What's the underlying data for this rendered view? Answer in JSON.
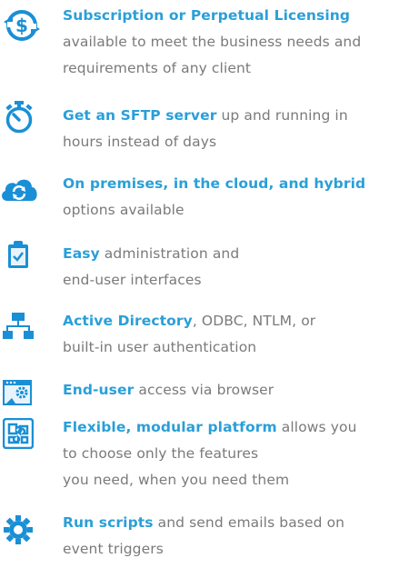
{
  "accent_color": "#2a9fd8",
  "icon_color": "#1a8fd6",
  "features": [
    {
      "icon": "dollar-cycle-icon",
      "highlight": "Subscription or Perpetual Licensing",
      "line1_rest": "",
      "line2": "available to meet the business needs and",
      "line3": "requirements of any client"
    },
    {
      "icon": "stopwatch-icon",
      "highlight": "Get an SFTP server",
      "line1_rest": " up and running in",
      "line2": "hours instead of days"
    },
    {
      "icon": "cloud-sync-icon",
      "highlight": "On premises, in the cloud, and hybrid",
      "line1_rest": "",
      "line2": "options available"
    },
    {
      "icon": "clipboard-check-icon",
      "highlight": "Easy",
      "line1_rest": " administration and",
      "line2": "end-user interfaces"
    },
    {
      "icon": "org-chart-icon",
      "highlight": "Active Directory",
      "line1_rest": ", ODBC, NTLM,  or",
      "line2": "built-in user authentication"
    },
    {
      "icon": "browser-gear-icon",
      "highlight": "End-user",
      "line1_rest": " access via browser"
    },
    {
      "icon": "puzzle-icon",
      "highlight": "Flexible, modular platform",
      "line1_rest": " allows you",
      "line2": "to choose only the features",
      "line3": "you need, when you need them"
    },
    {
      "icon": "gear-icon",
      "highlight": "Run scripts",
      "line1_rest": " and send emails based on",
      "line2": "event triggers"
    }
  ]
}
